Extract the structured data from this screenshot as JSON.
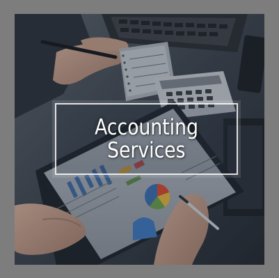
{
  "overlay": {
    "line1": "Accounting",
    "line2": "Services"
  },
  "colors": {
    "frame": "#7d7d7d",
    "photo_base": "#3a3f48",
    "text": "#ffffff"
  },
  "scene": {
    "description_icons": [
      "laptop-keyboard",
      "calculator",
      "clipboard-report",
      "pen",
      "notepad",
      "hands"
    ]
  }
}
